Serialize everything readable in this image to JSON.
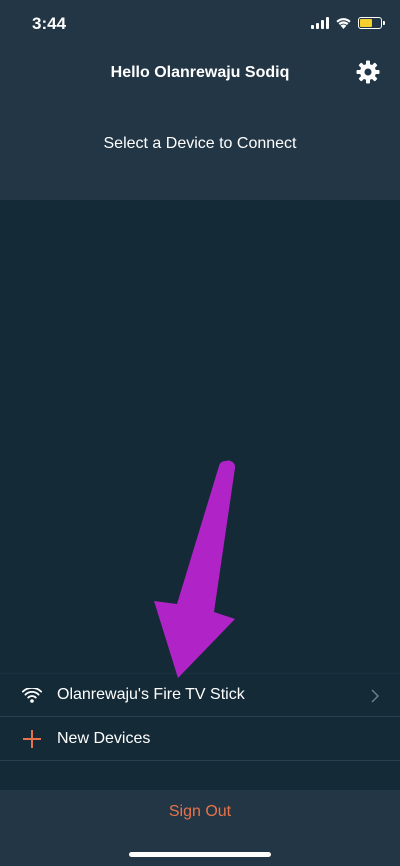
{
  "status_bar": {
    "time": "3:44",
    "battery_color": "#f5cf2c"
  },
  "header": {
    "greeting": "Hello Olanrewaju Sodiq",
    "subtitle": "Select a Device to Connect"
  },
  "devices": [
    {
      "label": "Olanrewaju's Fire TV Stick",
      "icon": "wifi-icon"
    },
    {
      "label": "New Devices",
      "icon": "plus-icon"
    }
  ],
  "footer": {
    "sign_out": "Sign Out"
  },
  "colors": {
    "accent": "#e8734a",
    "background": "#142a37",
    "panel": "#223645",
    "annotation_arrow": "#b023c6"
  }
}
